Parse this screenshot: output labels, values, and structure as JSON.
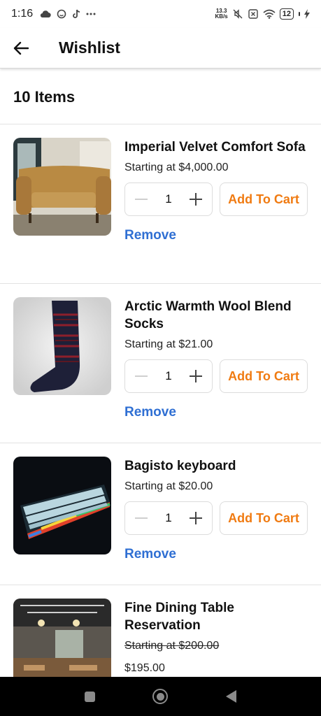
{
  "status_bar": {
    "time": "1:16",
    "net_speed_value": "13.3",
    "net_speed_unit": "KB/s",
    "battery": "12",
    "icons": [
      "cloud-icon",
      "face-icon",
      "tiktok-icon",
      "more-dots-icon",
      "mute-icon",
      "sim-x-icon",
      "wifi-icon",
      "battery-icon",
      "charging-icon"
    ]
  },
  "header": {
    "title": "Wishlist"
  },
  "summary": {
    "count_label": "10 Items"
  },
  "items": [
    {
      "name": "Imperial Velvet Comfort Sofa",
      "price": "Starting at $4,000.00",
      "quantity": "1",
      "cart_label": "Add To Cart",
      "remove_label": "Remove"
    },
    {
      "name": "Arctic Warmth Wool Blend Socks",
      "price": "Starting at $21.00",
      "quantity": "1",
      "cart_label": "Add To Cart",
      "remove_label": "Remove"
    },
    {
      "name": "Bagisto keyboard",
      "price": "Starting at $20.00",
      "quantity": "1",
      "cart_label": "Add To Cart",
      "remove_label": "Remove"
    },
    {
      "name": "Fine Dining Table Reservation",
      "price": "Starting at $200.00",
      "special_price": "$195.00"
    }
  ],
  "colors": {
    "accent": "#f07b12",
    "link": "#2f6fd3"
  }
}
